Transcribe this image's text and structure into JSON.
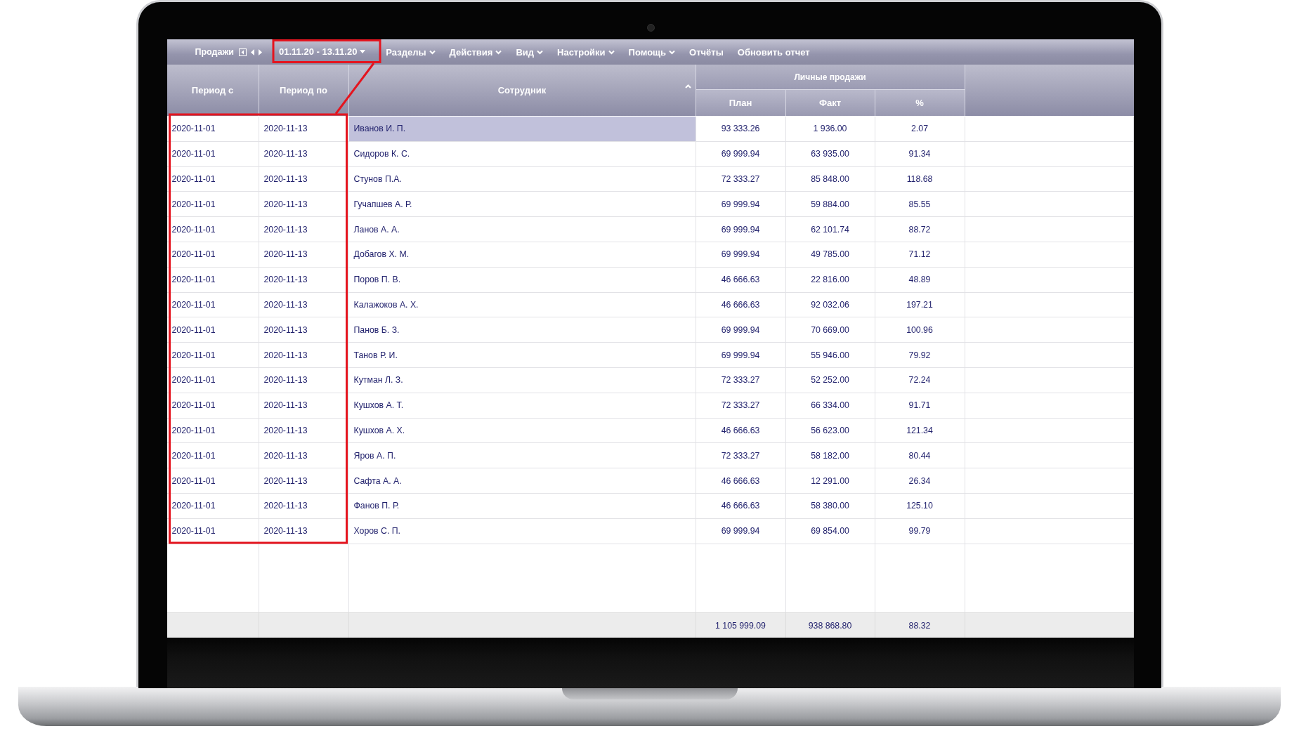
{
  "menu": {
    "title": "Продажи",
    "period": "01.11.20 - 13.11.20",
    "items": [
      {
        "label": "Разделы",
        "dropdown": true
      },
      {
        "label": "Действия",
        "dropdown": true
      },
      {
        "label": "Вид",
        "dropdown": true
      },
      {
        "label": "Настройки",
        "dropdown": true
      },
      {
        "label": "Помощь",
        "dropdown": true
      },
      {
        "label": "Отчёты",
        "dropdown": false
      },
      {
        "label": "Обновить отчет",
        "dropdown": false
      }
    ]
  },
  "table": {
    "columns": [
      {
        "label": "Период с",
        "sorted": false
      },
      {
        "label": "Период по",
        "sorted": false
      },
      {
        "label": "Сотрудник",
        "sorted": true
      }
    ],
    "group": {
      "label": "Личные продажи",
      "columns": [
        "План",
        "Факт",
        "%"
      ]
    },
    "rows": [
      {
        "period_from": "2020-11-01",
        "period_to": "2020-11-13",
        "employee": "Иванов И. П.",
        "plan": "93 333.26",
        "fact": "1 936.00",
        "percent": "2.07",
        "selected": true
      },
      {
        "period_from": "2020-11-01",
        "period_to": "2020-11-13",
        "employee": "Сидоров К. С.",
        "plan": "69 999.94",
        "fact": "63 935.00",
        "percent": "91.34",
        "selected": false
      },
      {
        "period_from": "2020-11-01",
        "period_to": "2020-11-13",
        "employee": "Стунов П.А.",
        "plan": "72 333.27",
        "fact": "85 848.00",
        "percent": "118.68",
        "selected": false
      },
      {
        "period_from": "2020-11-01",
        "period_to": "2020-11-13",
        "employee": "Гучапшев А. Р.",
        "plan": "69 999.94",
        "fact": "59 884.00",
        "percent": "85.55",
        "selected": false
      },
      {
        "period_from": "2020-11-01",
        "period_to": "2020-11-13",
        "employee": "Ланов А. А.",
        "plan": "69 999.94",
        "fact": "62 101.74",
        "percent": "88.72",
        "selected": false
      },
      {
        "period_from": "2020-11-01",
        "period_to": "2020-11-13",
        "employee": "Добагов Х. М.",
        "plan": "69 999.94",
        "fact": "49 785.00",
        "percent": "71.12",
        "selected": false
      },
      {
        "period_from": "2020-11-01",
        "period_to": "2020-11-13",
        "employee": "Поров П. В.",
        "plan": "46 666.63",
        "fact": "22 816.00",
        "percent": "48.89",
        "selected": false
      },
      {
        "period_from": "2020-11-01",
        "period_to": "2020-11-13",
        "employee": "Калажоков А. Х.",
        "plan": "46 666.63",
        "fact": "92 032.06",
        "percent": "197.21",
        "selected": false
      },
      {
        "period_from": "2020-11-01",
        "period_to": "2020-11-13",
        "employee": "Панов Б. З.",
        "plan": "69 999.94",
        "fact": "70 669.00",
        "percent": "100.96",
        "selected": false
      },
      {
        "period_from": "2020-11-01",
        "period_to": "2020-11-13",
        "employee": "Танов Р. И.",
        "plan": "69 999.94",
        "fact": "55 946.00",
        "percent": "79.92",
        "selected": false
      },
      {
        "period_from": "2020-11-01",
        "period_to": "2020-11-13",
        "employee": "Кутман Л. З.",
        "plan": "72 333.27",
        "fact": "52 252.00",
        "percent": "72.24",
        "selected": false
      },
      {
        "period_from": "2020-11-01",
        "period_to": "2020-11-13",
        "employee": "Кушхов А. Т.",
        "plan": "72 333.27",
        "fact": "66 334.00",
        "percent": "91.71",
        "selected": false
      },
      {
        "period_from": "2020-11-01",
        "period_to": "2020-11-13",
        "employee": "Кушхов А. Х.",
        "plan": "46 666.63",
        "fact": "56 623.00",
        "percent": "121.34",
        "selected": false
      },
      {
        "period_from": "2020-11-01",
        "period_to": "2020-11-13",
        "employee": "Яров А. П.",
        "plan": "72 333.27",
        "fact": "58 182.00",
        "percent": "80.44",
        "selected": false
      },
      {
        "period_from": "2020-11-01",
        "period_to": "2020-11-13",
        "employee": "Сафта А. А.",
        "plan": "46 666.63",
        "fact": "12 291.00",
        "percent": "26.34",
        "selected": false
      },
      {
        "period_from": "2020-11-01",
        "period_to": "2020-11-13",
        "employee": "Фанов П. Р.",
        "plan": "46 666.63",
        "fact": "58 380.00",
        "percent": "125.10",
        "selected": false
      },
      {
        "period_from": "2020-11-01",
        "period_to": "2020-11-13",
        "employee": "Хоров С. П.",
        "plan": "69 999.94",
        "fact": "69 854.00",
        "percent": "99.79",
        "selected": false
      }
    ],
    "totals": {
      "plan": "1 105 999.09",
      "fact": "938 868.80",
      "percent": "88.32"
    }
  }
}
